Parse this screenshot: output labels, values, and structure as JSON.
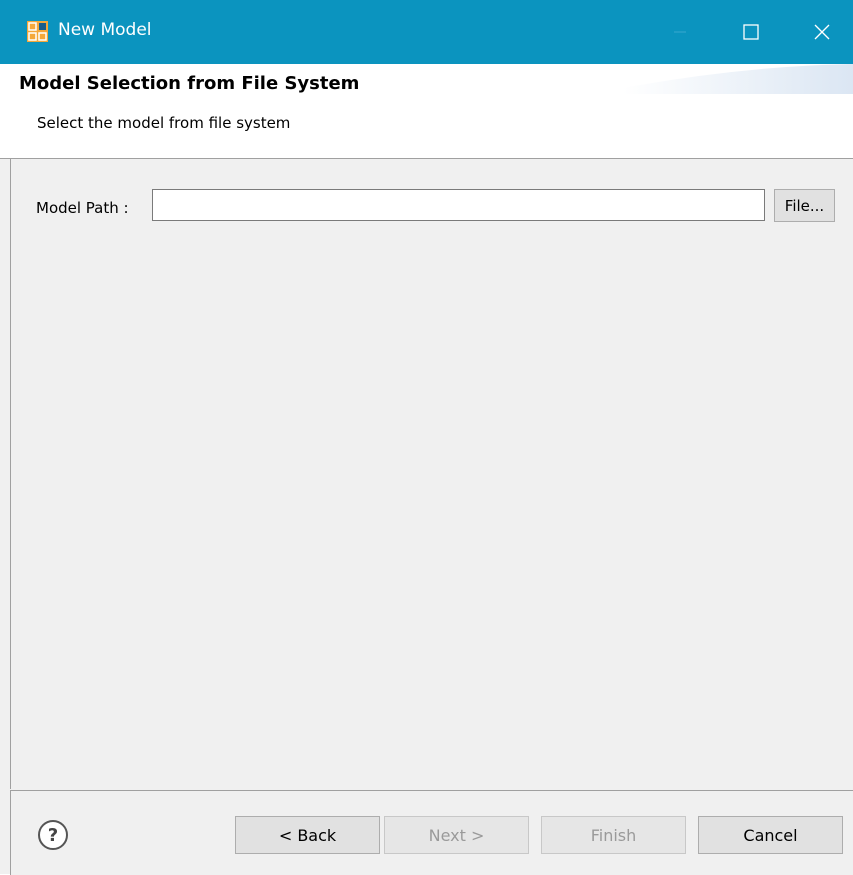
{
  "window": {
    "title": "New Model",
    "app_icon": "model-app-icon",
    "controls": [
      "minimize-icon",
      "maximize-icon",
      "close-icon"
    ]
  },
  "header": {
    "title": "Model Selection from File System",
    "description": "Select the model from file system"
  },
  "form": {
    "model_path_label": "Model Path :",
    "model_path_value": "",
    "file_button_label": "File..."
  },
  "footer": {
    "help_icon": "help-icon",
    "back_label": "< Back",
    "next_label": "Next >",
    "finish_label": "Finish",
    "cancel_label": "Cancel"
  },
  "colors": {
    "titlebar": "#0b94bf",
    "background": "#f0f0f0",
    "disabled_text": "#9a9a9a"
  }
}
